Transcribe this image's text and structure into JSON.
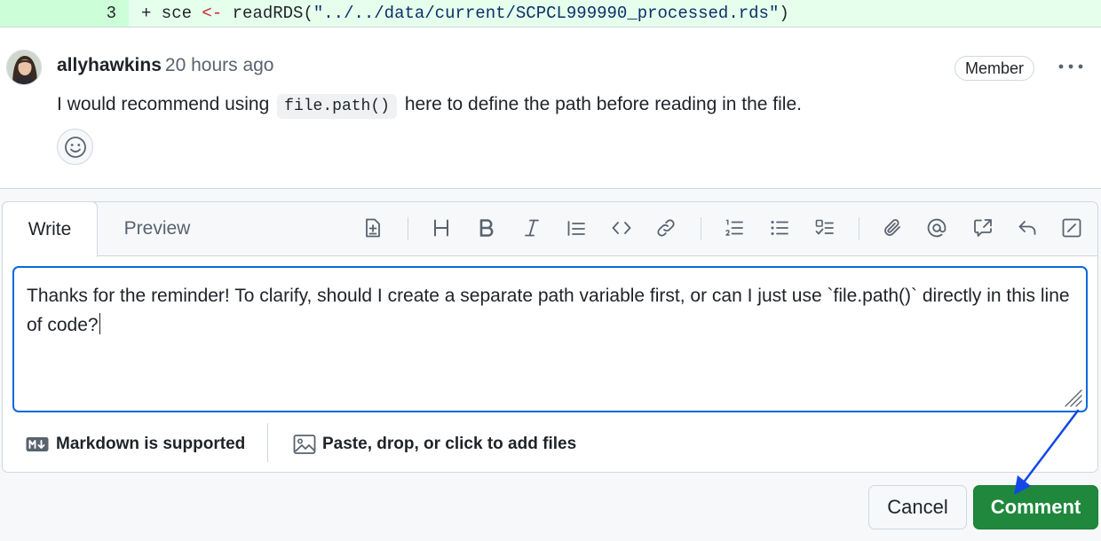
{
  "diff": {
    "line_number": "3",
    "code_prefix": "+ sce ",
    "code_operator": "<-",
    "code_func": " readRDS(",
    "code_string": "\"../../data/current/SCPCL999990_processed.rds\"",
    "code_suffix": ")"
  },
  "comment": {
    "author": "allyhawkins",
    "time": "20 hours ago",
    "badge": "Member",
    "body_before": "I would recommend using",
    "body_code": "file.path()",
    "body_after": "here to define the path before reading in the file."
  },
  "editor": {
    "tabs": [
      {
        "label": "Write",
        "active": true
      },
      {
        "label": "Preview",
        "active": false
      }
    ],
    "toolbar": [
      "template-icon",
      "heading-icon",
      "bold-icon",
      "italic-icon",
      "quote-icon",
      "code-icon",
      "link-icon",
      "ordered-list-icon",
      "unordered-list-icon",
      "task-list-icon",
      "attach-icon",
      "mention-icon",
      "reference-icon",
      "reply-icon",
      "fullscreen-icon"
    ],
    "text": "Thanks for the reminder! To clarify, should I create a separate path variable first, or can I just use `file.path()` directly in this line of code?",
    "markdown_note": "Markdown is supported",
    "files_note": "Paste, drop, or click to add files"
  },
  "actions": {
    "cancel": "Cancel",
    "submit": "Comment"
  },
  "colors": {
    "accent_blue": "#0969da",
    "submit_green": "#1f883d",
    "annotation_arrow": "#1447e6"
  }
}
